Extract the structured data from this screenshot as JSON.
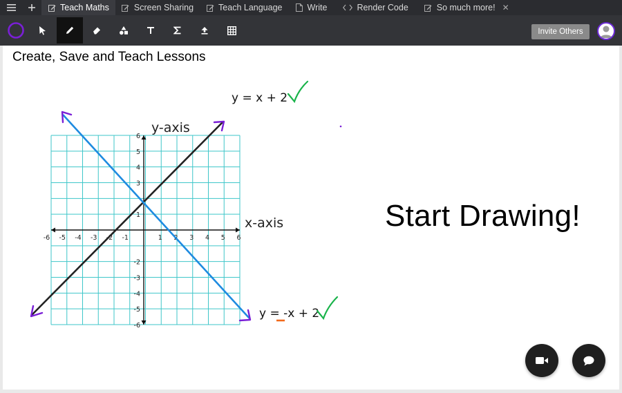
{
  "tabbar": {
    "tabs": [
      {
        "label": "Teach Maths",
        "icon": "edit-icon",
        "active": true
      },
      {
        "label": "Screen Sharing",
        "icon": "edit-icon"
      },
      {
        "label": "Teach Language",
        "icon": "edit-icon"
      },
      {
        "label": "Write",
        "icon": "document-icon"
      },
      {
        "label": "Render Code",
        "icon": "code-icon"
      },
      {
        "label": "So much more!",
        "icon": "edit-icon"
      }
    ]
  },
  "toolbar": {
    "tools": [
      "color-picker",
      "select",
      "pen",
      "eraser",
      "shapes",
      "text",
      "math-formula",
      "upload",
      "table"
    ],
    "active_tool": "pen",
    "invite_label": "Invite Others"
  },
  "canvas": {
    "headline": "Create, Save and Teach Lessons",
    "big_text": "Start Drawing!",
    "graph": {
      "y_axis_label": "y-axis",
      "x_axis_label": "x-axis",
      "x_ticks": [
        "-6",
        "-5",
        "-4",
        "-3",
        "-2",
        "-1",
        "1",
        "2",
        "3",
        "4",
        "5",
        "6"
      ],
      "y_ticks": [
        "6",
        "5",
        "4",
        "3",
        "1",
        "-2",
        "-3",
        "-4",
        "-5",
        "-6"
      ],
      "eq1": "y = x + 2",
      "eq2": "y = -x + 2"
    }
  },
  "colors": {
    "accent_purple": "#7a1fd6",
    "grid": "#3ec6c9",
    "blue_line": "#1e8be0",
    "check_green": "#19b34a",
    "underline_orange": "#f26a1b"
  }
}
